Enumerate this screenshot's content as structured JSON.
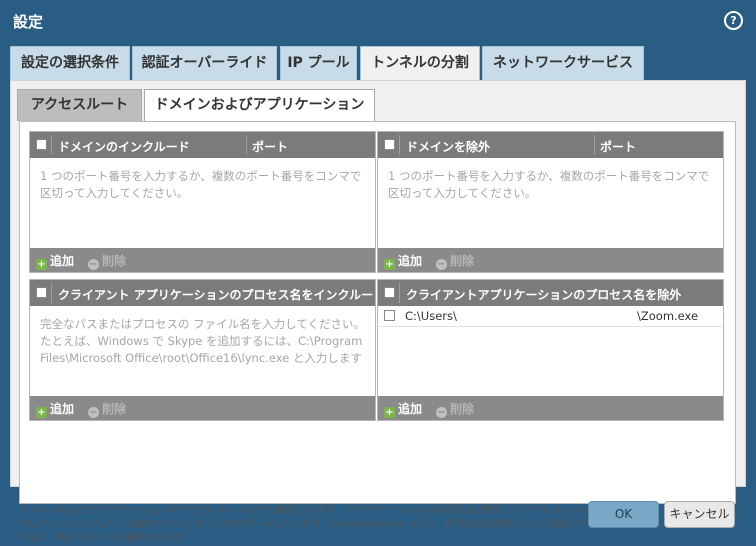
{
  "title": "設定",
  "help_icon": "help-icon",
  "tabs": [
    "設定の選択条件",
    "認証オーバーライド",
    "IP プール",
    "トンネルの分割",
    "ネットワークサービス"
  ],
  "subtabs": [
    "アクセスルート",
    "ドメインおよびアプリケーション"
  ],
  "panels": {
    "include_domain": {
      "col1": "ドメインのインクルード",
      "col2": "ポート",
      "placeholder": "1 つのポート番号を入力するか、複数のポート番号をコンマで区切って入力してください。"
    },
    "exclude_domain": {
      "col1": "ドメインを除外",
      "col2": "ポート",
      "placeholder": "1 つのポート番号を入力するか、複数のポート番号をコンマで区切って入力してください。"
    },
    "include_app": {
      "header": "クライアント アプリケーションのプロセス名をインクルード",
      "placeholder": "完全なパスまたはプロセスの ファイル名を入力してください。たとえば、Windows で Skype を追加するには、C:\\Program Files\\Microsoft Office\\root\\Office16\\lync.exe と入力します"
    },
    "exclude_app": {
      "header": "クライアントアプリケーションのプロセス名を除外",
      "row_left": "C:\\Users\\",
      "row_right": "\\Zoom.exe"
    }
  },
  "buttons": {
    "add": "追加",
    "delete": "削除"
  },
  "note": "ドメインおよびアプリケーションがアクセス ルートよりも優先されます。 アプリケーションの許可および除外リストがドメインよりも優先されます。 ドメインはプレフィックスとして、左端のワイルドカードをサポートしています（*.example.com など）。 許可および除外リストの両方でワイルドカードのドメインを指定すると、除外ドメインが優先されます。",
  "footer": {
    "ok": "OK",
    "cancel": "キャンセル"
  }
}
